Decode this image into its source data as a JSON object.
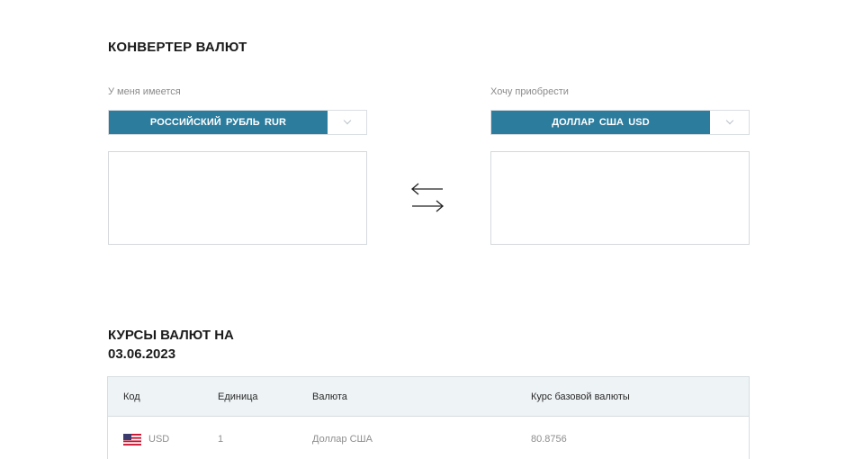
{
  "converter": {
    "title": "КОНВЕРТЕР ВАЛЮТ",
    "from": {
      "label": "У меня имеется",
      "currency": "РОССИЙСКИЙ РУБЛЬ  RUR",
      "amount": ""
    },
    "to": {
      "label": "Хочу приобрести",
      "currency": "ДОЛЛАР США  USD",
      "amount": ""
    },
    "swap_icon": "swap-arrows-icon"
  },
  "rates": {
    "title_line1": "КУРСЫ ВАЛЮТ НА",
    "title_line2": "03.06.2023",
    "columns": [
      "Код",
      "Единица",
      "Валюта",
      "Курс базовой валюты"
    ],
    "rows": [
      {
        "flag": "us-flag-icon",
        "code": "USD",
        "unit": "1",
        "name": "Доллар США",
        "rate": "80.8756"
      }
    ]
  },
  "colors": {
    "accent": "#2c7c9d",
    "table_header_bg": "#eef3f5",
    "border": "#d5d9dc"
  }
}
